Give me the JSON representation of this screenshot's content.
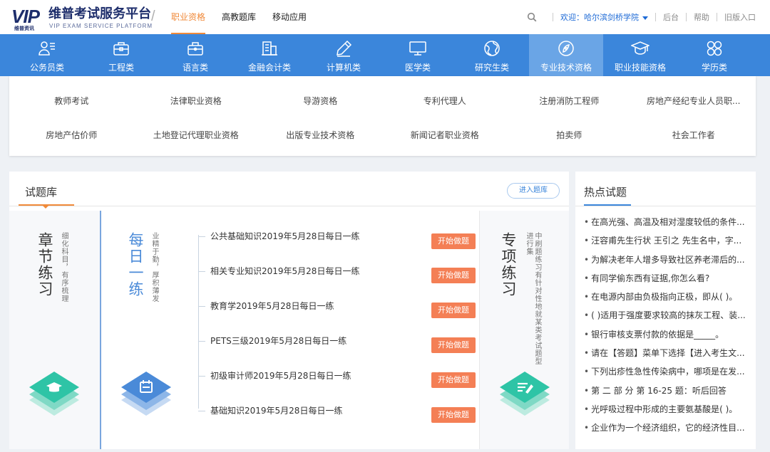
{
  "brand": {
    "logo_text": "VIP",
    "logo_sub": "维普资讯",
    "title": "维普考试服务平台",
    "subtitle": "VIP EXAM SERVICE PLATFORM"
  },
  "topnav": [
    {
      "label": "职业资格",
      "active": true
    },
    {
      "label": "高教题库",
      "active": false
    },
    {
      "label": "移动应用",
      "active": false
    }
  ],
  "user": {
    "welcome": "欢迎：哈尔滨剑桥学院",
    "links": [
      "后台",
      "帮助",
      "旧版入口"
    ]
  },
  "categories": [
    {
      "label": "公务员类",
      "icon": "civil-servant-icon"
    },
    {
      "label": "工程类",
      "icon": "toolbox-icon"
    },
    {
      "label": "语言类",
      "icon": "briefcase-icon"
    },
    {
      "label": "金融会计类",
      "icon": "bank-icon"
    },
    {
      "label": "计算机类",
      "icon": "pen-icon"
    },
    {
      "label": "医学类",
      "icon": "monitor-icon"
    },
    {
      "label": "研究生类",
      "icon": "globe-icon"
    },
    {
      "label": "专业技术资格",
      "icon": "compass-icon",
      "active": true
    },
    {
      "label": "职业技能资格",
      "icon": "graduation-cap-icon"
    },
    {
      "label": "学历类",
      "icon": "grid-circles-icon"
    }
  ],
  "subcategories": [
    "教师考试",
    "法律职业资格",
    "导游资格",
    "专利代理人",
    "注册消防工程师",
    "房地产经纪专业人员职...",
    "房地产估价师",
    "土地登记代理职业资格",
    "出版专业技术资格",
    "新闻记者职业资格",
    "拍卖师",
    "社会工作者"
  ],
  "bank": {
    "title": "试题库",
    "enter_label": "进入题库",
    "chapter": {
      "title": "章节练习",
      "desc": "细化科目，有序梳理"
    },
    "daily": {
      "title": "每日一练",
      "desc": "业精于勤，厚积薄发"
    },
    "special": {
      "title": "专项练习",
      "desc": "中刷题练习有针对性地就某类考试题型进行集"
    },
    "start_label": "开始做题",
    "daily_items": [
      "公共基础知识2019年5月28日每日一练",
      "相关专业知识2019年5月28日每日一练",
      "教育学2019年5月28日每日一练",
      "PETS三级2019年5月28日每日一练",
      "初级审计师2019年5月28日每日一练",
      "基础知识2019年5月28日每日一练"
    ]
  },
  "hot": {
    "title": "热点试题",
    "items": [
      "在高光强、高温及相对湿度较低的条件...",
      "汪容甫先生行状 王引之 先生名中，字...",
      "为解决老年人增多导致社区养老滞后的...",
      "有同学偷东西有证据,你怎么看?",
      "在电源内部由负极指向正极，即从( )。",
      "( )适用于强度要求较高的抹灰工程、装...",
      "银行审核支票付款的依据是_____。",
      "请在【答题】菜单下选择【进入考生文...",
      "下列出疹性急性传染病中，哪项是在发...",
      "第 二 部 分 第 16-25 题：听后回答",
      "光呼吸过程中形成的主要氨基酸是( )。",
      "企业作为一个经济组织，它的经济性目..."
    ]
  },
  "colors": {
    "nav_blue": "#3b86db",
    "accent_orange": "#f08a3a",
    "button_orange": "#f47f55",
    "teal": "#2ec4a6",
    "daily_blue": "#4a8ad8"
  }
}
